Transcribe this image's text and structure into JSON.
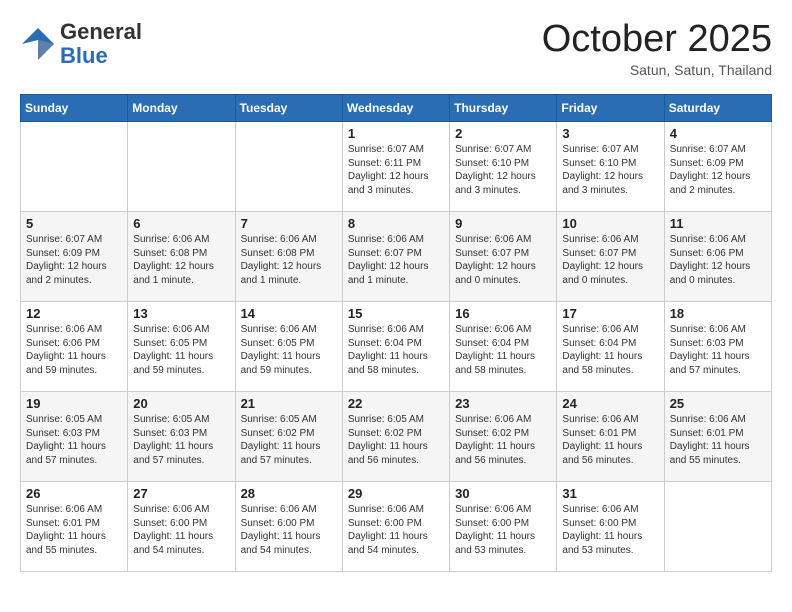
{
  "logo": {
    "general": "General",
    "blue": "Blue"
  },
  "header": {
    "month": "October 2025",
    "location": "Satun, Satun, Thailand"
  },
  "weekdays": [
    "Sunday",
    "Monday",
    "Tuesday",
    "Wednesday",
    "Thursday",
    "Friday",
    "Saturday"
  ],
  "weeks": [
    [
      {
        "day": "",
        "info": ""
      },
      {
        "day": "",
        "info": ""
      },
      {
        "day": "",
        "info": ""
      },
      {
        "day": "1",
        "info": "Sunrise: 6:07 AM\nSunset: 6:11 PM\nDaylight: 12 hours and 3 minutes."
      },
      {
        "day": "2",
        "info": "Sunrise: 6:07 AM\nSunset: 6:10 PM\nDaylight: 12 hours and 3 minutes."
      },
      {
        "day": "3",
        "info": "Sunrise: 6:07 AM\nSunset: 6:10 PM\nDaylight: 12 hours and 3 minutes."
      },
      {
        "day": "4",
        "info": "Sunrise: 6:07 AM\nSunset: 6:09 PM\nDaylight: 12 hours and 2 minutes."
      }
    ],
    [
      {
        "day": "5",
        "info": "Sunrise: 6:07 AM\nSunset: 6:09 PM\nDaylight: 12 hours and 2 minutes."
      },
      {
        "day": "6",
        "info": "Sunrise: 6:06 AM\nSunset: 6:08 PM\nDaylight: 12 hours and 1 minute."
      },
      {
        "day": "7",
        "info": "Sunrise: 6:06 AM\nSunset: 6:08 PM\nDaylight: 12 hours and 1 minute."
      },
      {
        "day": "8",
        "info": "Sunrise: 6:06 AM\nSunset: 6:07 PM\nDaylight: 12 hours and 1 minute."
      },
      {
        "day": "9",
        "info": "Sunrise: 6:06 AM\nSunset: 6:07 PM\nDaylight: 12 hours and 0 minutes."
      },
      {
        "day": "10",
        "info": "Sunrise: 6:06 AM\nSunset: 6:07 PM\nDaylight: 12 hours and 0 minutes."
      },
      {
        "day": "11",
        "info": "Sunrise: 6:06 AM\nSunset: 6:06 PM\nDaylight: 12 hours and 0 minutes."
      }
    ],
    [
      {
        "day": "12",
        "info": "Sunrise: 6:06 AM\nSunset: 6:06 PM\nDaylight: 11 hours and 59 minutes."
      },
      {
        "day": "13",
        "info": "Sunrise: 6:06 AM\nSunset: 6:05 PM\nDaylight: 11 hours and 59 minutes."
      },
      {
        "day": "14",
        "info": "Sunrise: 6:06 AM\nSunset: 6:05 PM\nDaylight: 11 hours and 59 minutes."
      },
      {
        "day": "15",
        "info": "Sunrise: 6:06 AM\nSunset: 6:04 PM\nDaylight: 11 hours and 58 minutes."
      },
      {
        "day": "16",
        "info": "Sunrise: 6:06 AM\nSunset: 6:04 PM\nDaylight: 11 hours and 58 minutes."
      },
      {
        "day": "17",
        "info": "Sunrise: 6:06 AM\nSunset: 6:04 PM\nDaylight: 11 hours and 58 minutes."
      },
      {
        "day": "18",
        "info": "Sunrise: 6:06 AM\nSunset: 6:03 PM\nDaylight: 11 hours and 57 minutes."
      }
    ],
    [
      {
        "day": "19",
        "info": "Sunrise: 6:05 AM\nSunset: 6:03 PM\nDaylight: 11 hours and 57 minutes."
      },
      {
        "day": "20",
        "info": "Sunrise: 6:05 AM\nSunset: 6:03 PM\nDaylight: 11 hours and 57 minutes."
      },
      {
        "day": "21",
        "info": "Sunrise: 6:05 AM\nSunset: 6:02 PM\nDaylight: 11 hours and 57 minutes."
      },
      {
        "day": "22",
        "info": "Sunrise: 6:05 AM\nSunset: 6:02 PM\nDaylight: 11 hours and 56 minutes."
      },
      {
        "day": "23",
        "info": "Sunrise: 6:06 AM\nSunset: 6:02 PM\nDaylight: 11 hours and 56 minutes."
      },
      {
        "day": "24",
        "info": "Sunrise: 6:06 AM\nSunset: 6:01 PM\nDaylight: 11 hours and 56 minutes."
      },
      {
        "day": "25",
        "info": "Sunrise: 6:06 AM\nSunset: 6:01 PM\nDaylight: 11 hours and 55 minutes."
      }
    ],
    [
      {
        "day": "26",
        "info": "Sunrise: 6:06 AM\nSunset: 6:01 PM\nDaylight: 11 hours and 55 minutes."
      },
      {
        "day": "27",
        "info": "Sunrise: 6:06 AM\nSunset: 6:00 PM\nDaylight: 11 hours and 54 minutes."
      },
      {
        "day": "28",
        "info": "Sunrise: 6:06 AM\nSunset: 6:00 PM\nDaylight: 11 hours and 54 minutes."
      },
      {
        "day": "29",
        "info": "Sunrise: 6:06 AM\nSunset: 6:00 PM\nDaylight: 11 hours and 54 minutes."
      },
      {
        "day": "30",
        "info": "Sunrise: 6:06 AM\nSunset: 6:00 PM\nDaylight: 11 hours and 53 minutes."
      },
      {
        "day": "31",
        "info": "Sunrise: 6:06 AM\nSunset: 6:00 PM\nDaylight: 11 hours and 53 minutes."
      },
      {
        "day": "",
        "info": ""
      }
    ]
  ]
}
